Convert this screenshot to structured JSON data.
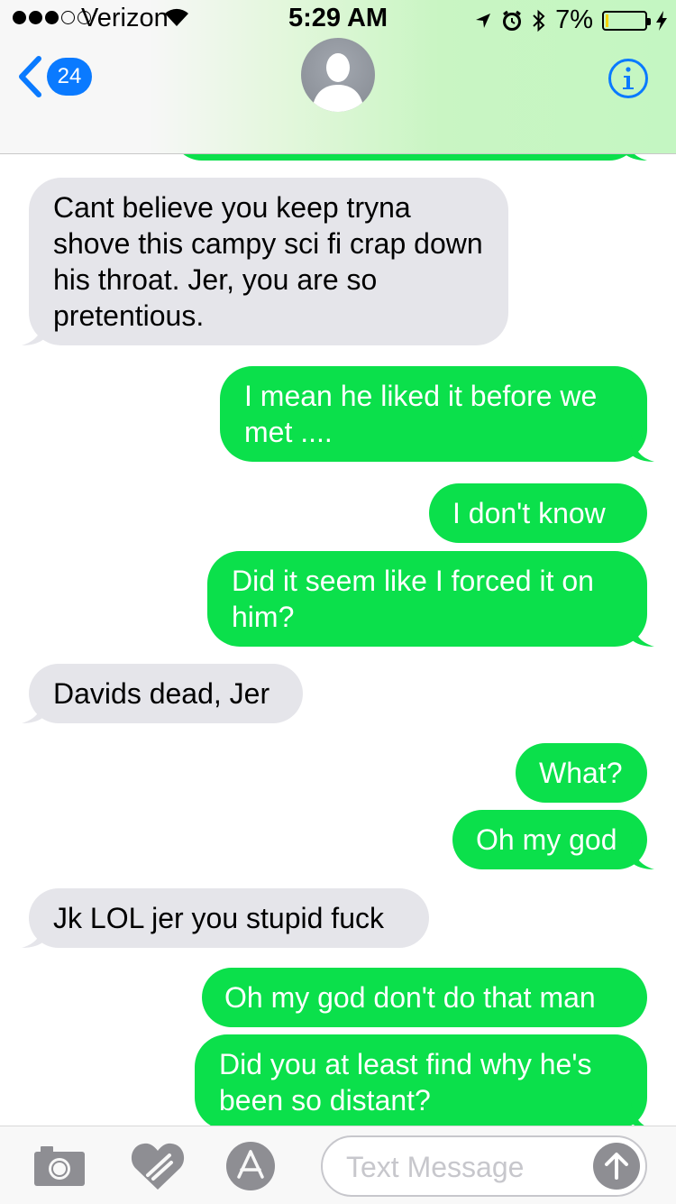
{
  "status_bar": {
    "carrier": "Verizon",
    "time": "5:29 AM",
    "battery_text": "7%",
    "battery_level": 0.07,
    "battery_color": "#f5d300"
  },
  "header": {
    "unread_count": "24",
    "back_icon": "chevron-left-icon",
    "avatar_icon": "person-silhouette-icon",
    "info_icon": "info-icon",
    "accent_color": "#0a7aff"
  },
  "messages": [
    {
      "from": "sent",
      "text": ""
    },
    {
      "from": "received",
      "text": "Cant believe you keep tryna shove this campy sci fi crap down his throat. Jer, you are so pretentious."
    },
    {
      "from": "sent",
      "text": "I mean he liked it before we met ...."
    },
    {
      "from": "sent",
      "text": "I don't know"
    },
    {
      "from": "sent",
      "text": "Did it seem like I forced it on him?"
    },
    {
      "from": "received",
      "text": "Davids dead, Jer"
    },
    {
      "from": "sent",
      "text": "What?"
    },
    {
      "from": "sent",
      "text": "Oh my god"
    },
    {
      "from": "received",
      "text": "Jk LOL jer you stupid fuck"
    },
    {
      "from": "sent",
      "text": "Oh my god don't do that man"
    },
    {
      "from": "sent",
      "text": "Did you at least find why he's been so distant?"
    }
  ],
  "colors": {
    "sent_bubble": "#0be04b",
    "received_bubble": "#e5e5ea"
  },
  "composer": {
    "placeholder": "Text Message",
    "value": "",
    "camera_icon": "camera-icon",
    "digital_touch_icon": "heart-touch-icon",
    "apps_icon": "app-store-icon",
    "send_icon": "send-arrow-icon"
  }
}
